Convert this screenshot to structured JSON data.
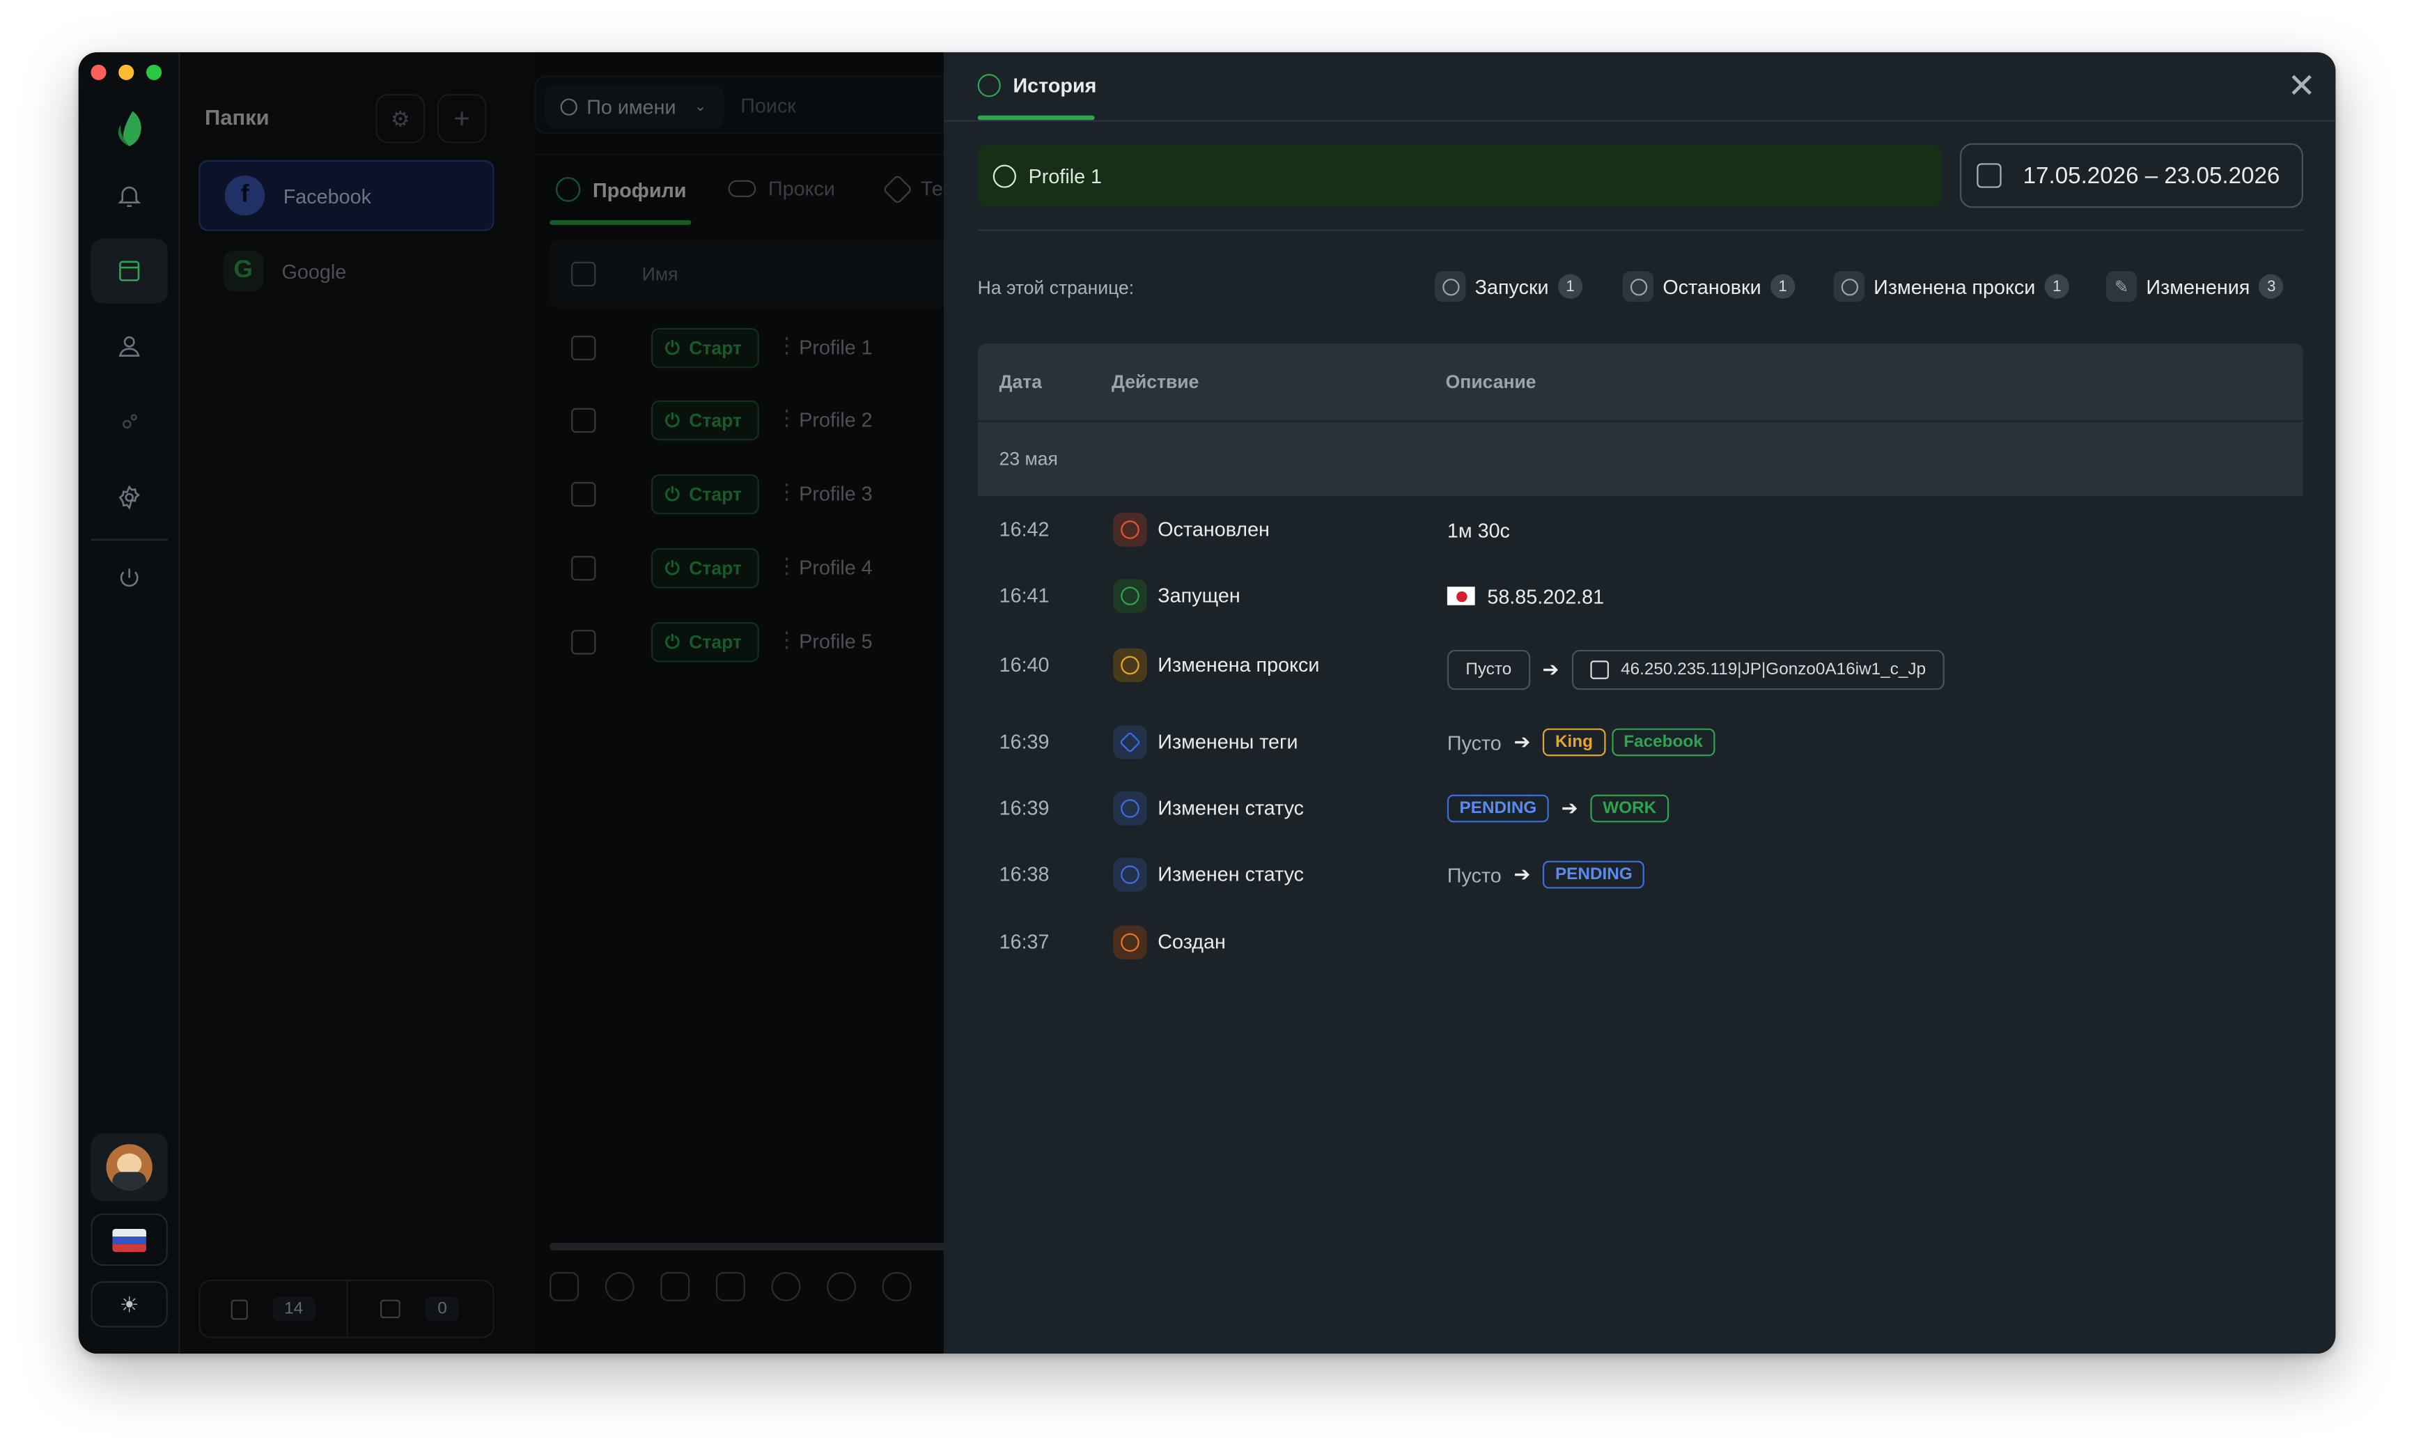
{
  "window_controls": {
    "close_color": "#ff5f57",
    "minimize_color": "#febc2e",
    "maximize_color": "#28c840"
  },
  "rail": {
    "items": [
      "logo-icon",
      "bell-icon",
      "browser-icon",
      "user-icon",
      "cog-small-icon",
      "gear-icon",
      "power-icon"
    ],
    "active": "browser-icon",
    "bottom": [
      "avatar",
      "russia-flag-icon",
      "sun-icon"
    ]
  },
  "folders": {
    "title": "Папки",
    "items": [
      {
        "label": "Facebook",
        "icon": "facebook-icon",
        "active": true
      },
      {
        "label": "Google",
        "icon": "google-icon",
        "active": false
      }
    ],
    "footer": {
      "trash_count": "14",
      "archive_count": "0"
    }
  },
  "main": {
    "search_mode": "По имени",
    "search_placeholder": "Поиск",
    "tabs": [
      {
        "label": "Профили",
        "active": true
      },
      {
        "label": "Прокси"
      },
      {
        "label": "Те"
      }
    ],
    "column_name": "Имя",
    "rows": [
      {
        "start_label": "Старт",
        "name": "Profile 1"
      },
      {
        "start_label": "Старт",
        "name": "Profile 2"
      },
      {
        "start_label": "Старт",
        "name": "Profile 3"
      },
      {
        "start_label": "Старт",
        "name": "Profile 4"
      },
      {
        "start_label": "Старт",
        "name": "Profile 5"
      }
    ]
  },
  "history": {
    "tab_label": "История",
    "profile_name": "Profile 1",
    "date_range": "17.05.2026 – 23.05.2026",
    "on_page_label": "На этой странице:",
    "filters": [
      {
        "label": "Запуски",
        "count": "1"
      },
      {
        "label": "Остановки",
        "count": "1"
      },
      {
        "label": "Изменена прокси",
        "count": "1"
      },
      {
        "label": "Изменения",
        "count": "3"
      }
    ],
    "columns": {
      "date": "Дата",
      "action": "Действие",
      "description": "Описание"
    },
    "group_date": "23 мая",
    "rows": [
      {
        "time": "16:42",
        "action": "Остановлен",
        "description": "1м 30с"
      },
      {
        "time": "16:41",
        "action": "Запущен",
        "ip": "58.85.202.81",
        "flag": "jp-flag-icon"
      },
      {
        "time": "16:40",
        "action": "Изменена прокси",
        "from": "Пусто",
        "to": "46.250.235.119|JP|Gonzo0A16iw1_c_Jp"
      },
      {
        "time": "16:39",
        "action": "Изменены теги",
        "from": "Пусто",
        "tags": [
          "King",
          "Facebook"
        ]
      },
      {
        "time": "16:39",
        "action": "Изменен статус",
        "from": "PENDING",
        "to": "WORK"
      },
      {
        "time": "16:38",
        "action": "Изменен статус",
        "from": "Пусто",
        "to": "PENDING"
      },
      {
        "time": "16:37",
        "action": "Создан"
      }
    ]
  },
  "colors": {
    "accent_green": "#2ea44f",
    "blue_status": "#3b6fe0",
    "tag_king": "#e3a72a",
    "stop_red": "#e5533d"
  }
}
